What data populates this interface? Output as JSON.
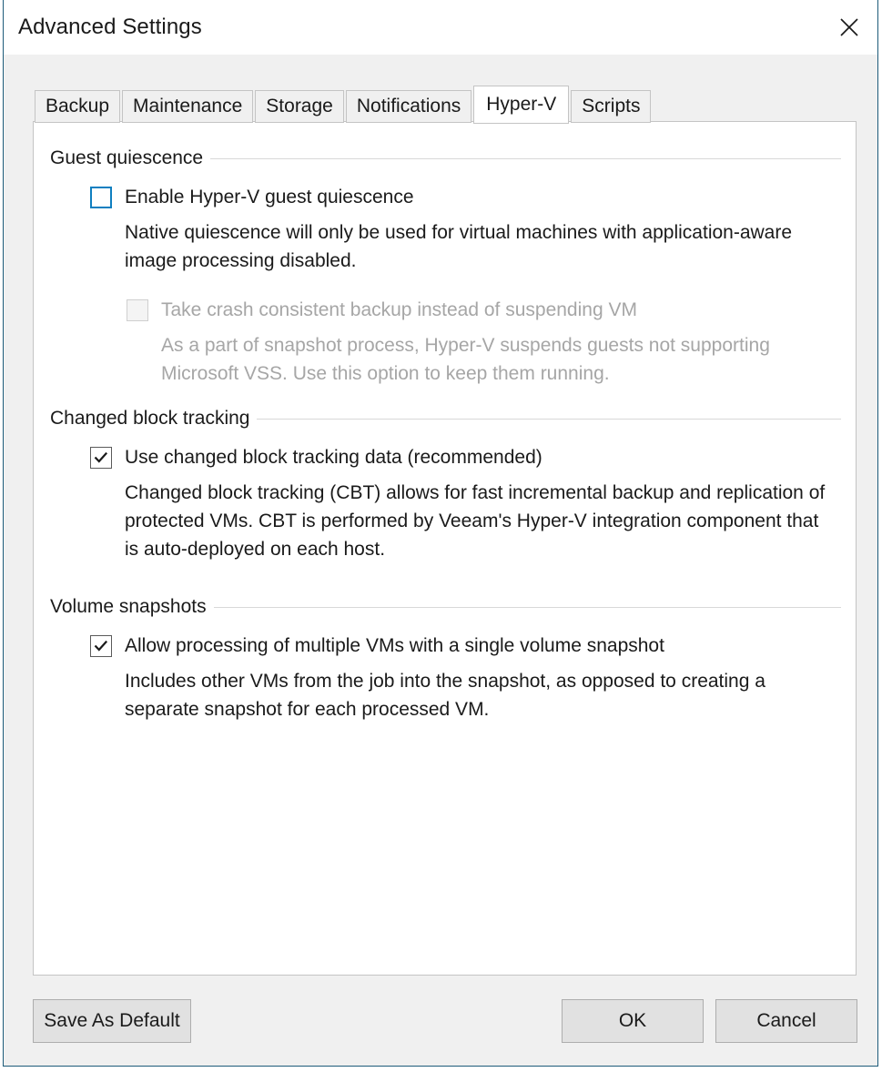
{
  "window": {
    "title": "Advanced Settings",
    "close_icon": "close-icon"
  },
  "tabs": [
    {
      "label": "Backup",
      "selected": false
    },
    {
      "label": "Maintenance",
      "selected": false
    },
    {
      "label": "Storage",
      "selected": false
    },
    {
      "label": "Notifications",
      "selected": false
    },
    {
      "label": "Hyper-V",
      "selected": true
    },
    {
      "label": "Scripts",
      "selected": false
    }
  ],
  "groups": {
    "guest_quiescence": {
      "title": "Guest quiescence",
      "enable_quiescence": {
        "label": "Enable Hyper-V guest quiescence",
        "checked": false,
        "state": "hover",
        "description": "Native quiescence will only be used for virtual machines with application-aware image processing disabled."
      },
      "crash_consistent": {
        "label": "Take crash consistent backup instead of suspending VM",
        "checked": false,
        "state": "disabled",
        "description": "As a part of snapshot process, Hyper-V suspends guests not supporting Microsoft VSS. Use this option to keep them running."
      }
    },
    "changed_block_tracking": {
      "title": "Changed block tracking",
      "use_cbt": {
        "label": "Use changed block tracking data (recommended)",
        "checked": true,
        "state": "enabled",
        "description": "Changed block tracking (CBT) allows for fast incremental backup and replication of protected VMs. CBT is performed by Veeam's Hyper-V integration component that is auto-deployed on each host."
      }
    },
    "volume_snapshots": {
      "title": "Volume snapshots",
      "allow_multi_vm": {
        "label": "Allow processing of multiple VMs with a single volume snapshot",
        "checked": true,
        "state": "enabled",
        "description": "Includes other VMs from the job into the snapshot, as opposed to creating a separate snapshot for each processed VM."
      }
    }
  },
  "footer": {
    "save_as_default_label": "Save As Default",
    "ok_label": "OK",
    "cancel_label": "Cancel"
  },
  "colors": {
    "accent_blue": "#0f7fc0",
    "window_bg": "#f0f0f0",
    "panel_bg": "#ffffff",
    "text": "#1a1a1a",
    "disabled_text": "#a6a6a6",
    "border": "#c4c4c4"
  }
}
